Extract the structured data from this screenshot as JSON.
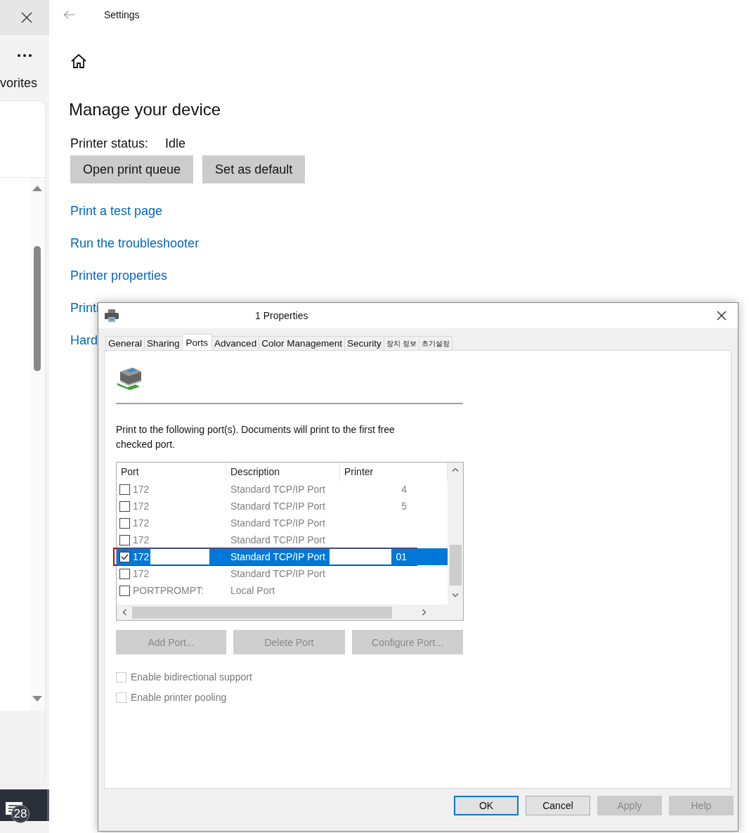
{
  "sidebar": {
    "partial_label": "vorites",
    "notification_count": "28"
  },
  "settings": {
    "title": "Settings",
    "heading": "Manage your device",
    "status_label": "Printer status:",
    "status_value": "Idle",
    "buttons": [
      "Open print queue",
      "Set as default"
    ],
    "links": [
      "Print a test page",
      "Run the troubleshooter",
      "Printer properties",
      "Printi",
      "Hard"
    ]
  },
  "dialog": {
    "title": "1 Properties",
    "tabs": [
      {
        "label": "General",
        "selected": false
      },
      {
        "label": "Sharing",
        "selected": false
      },
      {
        "label": "Ports",
        "selected": true
      },
      {
        "label": "Advanced",
        "selected": false
      },
      {
        "label": "Color Management",
        "selected": false
      },
      {
        "label": "Security",
        "selected": false
      },
      {
        "label": "장치 정보",
        "selected": false
      },
      {
        "label": "초기설정",
        "selected": false
      }
    ],
    "description": "Print to the following port(s). Documents will print to the first free checked port.",
    "columns": [
      "Port",
      "Description",
      "Printer"
    ],
    "ports": [
      {
        "port": "172",
        "description": "Standard TCP/IP Port",
        "printer": "4",
        "checked": false,
        "selected": false,
        "redacted": false
      },
      {
        "port": "172",
        "description": "Standard TCP/IP Port",
        "printer": "5",
        "checked": false,
        "selected": false,
        "redacted": false
      },
      {
        "port": "172",
        "description": "Standard TCP/IP Port",
        "checked": false,
        "selected": false,
        "redacted": false
      },
      {
        "port": "172",
        "description": "Standard TCP/IP Port",
        "checked": false,
        "selected": false,
        "redacted": false
      },
      {
        "port": "172",
        "description": "Standard TCP/IP Port",
        "printer": "01",
        "checked": true,
        "selected": true,
        "redacted": true
      },
      {
        "port": "172",
        "description": "Standard TCP/IP Port",
        "checked": false,
        "selected": false,
        "redacted": false
      },
      {
        "port": "PORTPROMPT:",
        "description": "Local Port",
        "checked": false,
        "selected": false,
        "redacted": false
      }
    ],
    "port_buttons": [
      {
        "label": "Add Port...",
        "disabled": true
      },
      {
        "label": "Delete Port",
        "disabled": true
      },
      {
        "label": "Configure Port...",
        "disabled": true
      }
    ],
    "options": [
      {
        "label": "Enable bidirectional support",
        "checked": false,
        "disabled": true
      },
      {
        "label": "Enable printer pooling",
        "checked": false,
        "disabled": true
      }
    ],
    "buttons": [
      {
        "label": "OK",
        "default": true,
        "disabled": false
      },
      {
        "label": "Cancel",
        "default": false,
        "disabled": false
      },
      {
        "label": "Apply",
        "default": false,
        "disabled": true
      },
      {
        "label": "Help",
        "default": false,
        "disabled": true
      }
    ]
  }
}
